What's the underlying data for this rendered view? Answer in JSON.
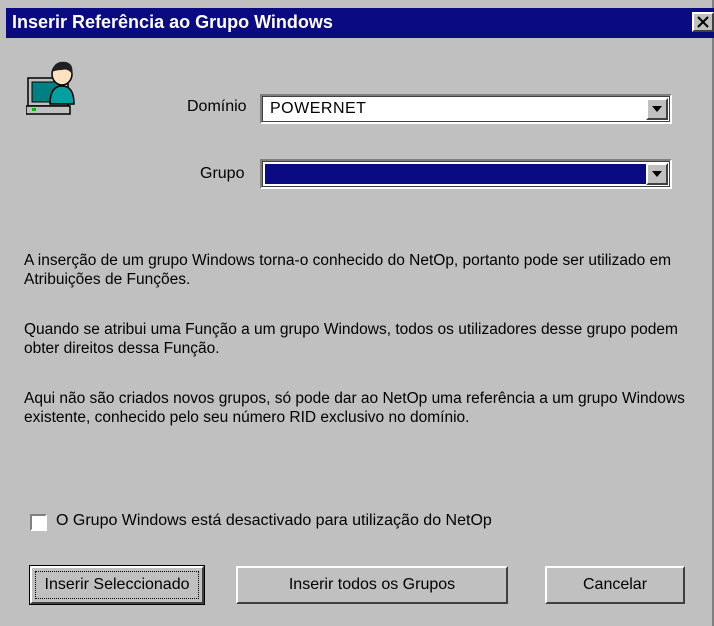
{
  "window": {
    "title": "Inserir Referência ao Grupo Windows",
    "title_bar_color": "#0a0a82",
    "close_icon": "close-icon"
  },
  "app_icon": "user-computer-icon",
  "domain_field": {
    "label": "Domínio",
    "value": "POWERNET"
  },
  "group_field": {
    "label": "Grupo",
    "value": ""
  },
  "description": [
    "A inserção de um grupo Windows torna-o conhecido do NetOp, portanto pode ser utilizado em Atribuições de Funções.",
    "Quando se atribui uma Função a um grupo Windows, todos os utilizadores desse grupo podem obter direitos dessa Função.",
    "Aqui não são criados novos grupos, só pode dar ao NetOp uma referência a um grupo Windows existente, conhecido pelo seu número RID exclusivo no domínio."
  ],
  "disabled_checkbox": {
    "label": "O Grupo Windows está desactivado para utilização do NetOp",
    "checked": false
  },
  "buttons": {
    "insert_selected": "Inserir Seleccionado",
    "insert_all": "Inserir todos os Grupos",
    "cancel": "Cancelar"
  }
}
